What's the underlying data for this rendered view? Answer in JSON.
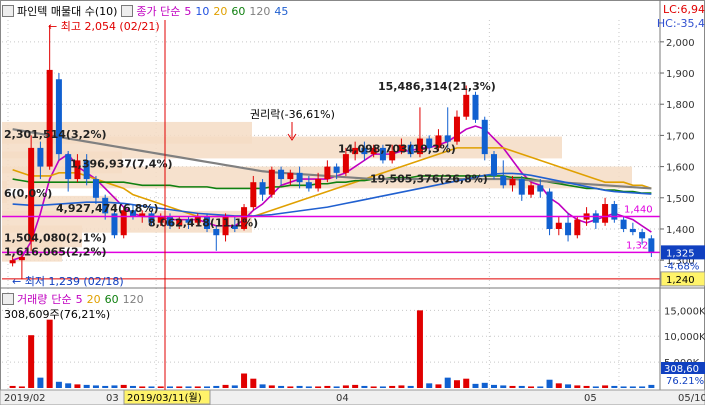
{
  "header": {
    "stock_name": "파인텍 매물대 수(10)",
    "ma_label": "종가 단순",
    "ma_periods": [
      "5",
      "10",
      "20",
      "60",
      "120",
      "45"
    ],
    "ma_colors": [
      "#c000c0",
      "#2050e0",
      "#e0a000",
      "#108010",
      "#808080",
      "#2060d0"
    ],
    "lc_text": "LC:6,94",
    "hc_text": "HC:-35,4"
  },
  "price_axis": {
    "ticks": [
      "2,000",
      "1,900",
      "1,800",
      "1,700",
      "1,600",
      "1,500",
      "1,400",
      "1,300"
    ],
    "current_price": "1,325",
    "current_change": "-4.68%",
    "low_line_label": "1,240"
  },
  "volume_axis": {
    "ticks": [
      "15,000K",
      "10,000K",
      "5,000K"
    ],
    "current_volume": "308,60",
    "current_ratio": "76.21%"
  },
  "volume_legend": {
    "label": "거래량",
    "ma_label": "단순",
    "periods": [
      "5",
      "20",
      "60",
      "120"
    ],
    "colors": [
      "#c000c0",
      "#e0a000",
      "#108010",
      "#808080"
    ],
    "current": "308,609주(76,21%)"
  },
  "date_axis": {
    "labels": [
      "2019/02",
      "03",
      "04",
      "05",
      "05/10"
    ],
    "cursor_label": "2019/03/11(월)"
  },
  "annotations": {
    "high": "최고 2,054 (02/21)",
    "low": "최저 1,239 (02/18)",
    "rights": "권리락(-36,61%)",
    "line_1440": "1,440",
    "line_1325": "1,32"
  },
  "volume_profile": [
    {
      "label": "2,301,514(3,2%)",
      "price": 1705,
      "len": 250
    },
    {
      "label": "14,098,703(19,3%)",
      "price": 1658,
      "len": 560
    },
    {
      "label": "15,486,314(21,3%)",
      "price": 1705,
      "len": 0
    },
    {
      "label": "1,396,937(7,4%)",
      "price": 1610,
      "len": 120
    },
    {
      "label": "19,505,376(26,8%)",
      "price": 1562,
      "len": 630
    },
    {
      "label": "6(0,0%)",
      "price": 1515,
      "len": 5
    },
    {
      "label": "4,927,474(6,8%)",
      "price": 1468,
      "len": 115
    },
    {
      "label": "8,062,418(11,1%)",
      "price": 1420,
      "len": 250
    },
    {
      "label": "1,504,080(2,1%)",
      "price": 1373,
      "len": 80
    },
    {
      "label": "1,616,065(2,2%)",
      "price": 1327,
      "len": 60
    }
  ],
  "chart_data": {
    "type": "candlestick",
    "ylim": [
      1230,
      2070
    ],
    "y_ticks": [
      2000,
      1900,
      1800,
      1700,
      1600,
      1500,
      1400,
      1300
    ],
    "candles": [
      {
        "o": 1290,
        "c": 1300,
        "h": 1315,
        "l": 1280
      },
      {
        "o": 1300,
        "c": 1310,
        "h": 1320,
        "l": 1239
      },
      {
        "o": 1360,
        "c": 1660,
        "h": 1700,
        "l": 1330
      },
      {
        "o": 1660,
        "c": 1600,
        "h": 1680,
        "l": 1560
      },
      {
        "o": 1600,
        "c": 1910,
        "h": 2054,
        "l": 1590
      },
      {
        "o": 1880,
        "c": 1640,
        "h": 1900,
        "l": 1620
      },
      {
        "o": 1640,
        "c": 1560,
        "h": 1650,
        "l": 1520
      },
      {
        "o": 1560,
        "c": 1620,
        "h": 1640,
        "l": 1550
      },
      {
        "o": 1620,
        "c": 1560,
        "h": 1640,
        "l": 1540
      },
      {
        "o": 1560,
        "c": 1500,
        "h": 1570,
        "l": 1480
      },
      {
        "o": 1500,
        "c": 1450,
        "h": 1510,
        "l": 1430
      },
      {
        "o": 1450,
        "c": 1380,
        "h": 1460,
        "l": 1370
      },
      {
        "o": 1380,
        "c": 1460,
        "h": 1470,
        "l": 1370
      },
      {
        "o": 1460,
        "c": 1440,
        "h": 1480,
        "l": 1430
      },
      {
        "o": 1440,
        "c": 1450,
        "h": 1460,
        "l": 1420
      },
      {
        "o": 1450,
        "c": 1420,
        "h": 1460,
        "l": 1410
      },
      {
        "o": 1420,
        "c": 1440,
        "h": 1450,
        "l": 1410
      },
      {
        "o": 1440,
        "c": 1410,
        "h": 1450,
        "l": 1400
      },
      {
        "o": 1410,
        "c": 1430,
        "h": 1440,
        "l": 1400
      },
      {
        "o": 1430,
        "c": 1420,
        "h": 1440,
        "l": 1400
      },
      {
        "o": 1420,
        "c": 1440,
        "h": 1450,
        "l": 1410
      },
      {
        "o": 1440,
        "c": 1400,
        "h": 1450,
        "l": 1390
      },
      {
        "o": 1400,
        "c": 1380,
        "h": 1410,
        "l": 1330
      },
      {
        "o": 1380,
        "c": 1440,
        "h": 1450,
        "l": 1360
      },
      {
        "o": 1410,
        "c": 1400,
        "h": 1440,
        "l": 1390
      },
      {
        "o": 1400,
        "c": 1470,
        "h": 1480,
        "l": 1395
      },
      {
        "o": 1470,
        "c": 1550,
        "h": 1570,
        "l": 1460
      },
      {
        "o": 1550,
        "c": 1510,
        "h": 1560,
        "l": 1490
      },
      {
        "o": 1510,
        "c": 1590,
        "h": 1600,
        "l": 1500
      },
      {
        "o": 1590,
        "c": 1560,
        "h": 1600,
        "l": 1540
      },
      {
        "o": 1560,
        "c": 1580,
        "h": 1590,
        "l": 1540
      },
      {
        "o": 1580,
        "c": 1550,
        "h": 1600,
        "l": 1530
      },
      {
        "o": 1550,
        "c": 1530,
        "h": 1570,
        "l": 1520
      },
      {
        "o": 1530,
        "c": 1560,
        "h": 1580,
        "l": 1520
      },
      {
        "o": 1560,
        "c": 1600,
        "h": 1620,
        "l": 1550
      },
      {
        "o": 1600,
        "c": 1580,
        "h": 1610,
        "l": 1560
      },
      {
        "o": 1580,
        "c": 1640,
        "h": 1660,
        "l": 1570
      },
      {
        "o": 1640,
        "c": 1660,
        "h": 1680,
        "l": 1620
      },
      {
        "o": 1660,
        "c": 1640,
        "h": 1680,
        "l": 1620
      },
      {
        "o": 1640,
        "c": 1660,
        "h": 1670,
        "l": 1630
      },
      {
        "o": 1660,
        "c": 1620,
        "h": 1670,
        "l": 1610
      },
      {
        "o": 1620,
        "c": 1650,
        "h": 1670,
        "l": 1610
      },
      {
        "o": 1650,
        "c": 1670,
        "h": 1690,
        "l": 1640
      },
      {
        "o": 1670,
        "c": 1640,
        "h": 1680,
        "l": 1630
      },
      {
        "o": 1640,
        "c": 1690,
        "h": 1790,
        "l": 1630
      },
      {
        "o": 1690,
        "c": 1660,
        "h": 1700,
        "l": 1640
      },
      {
        "o": 1660,
        "c": 1700,
        "h": 1720,
        "l": 1650
      },
      {
        "o": 1700,
        "c": 1680,
        "h": 1790,
        "l": 1660
      },
      {
        "o": 1680,
        "c": 1760,
        "h": 1780,
        "l": 1670
      },
      {
        "o": 1760,
        "c": 1830,
        "h": 1860,
        "l": 1750
      },
      {
        "o": 1830,
        "c": 1750,
        "h": 1840,
        "l": 1740
      },
      {
        "o": 1750,
        "c": 1640,
        "h": 1760,
        "l": 1620
      },
      {
        "o": 1640,
        "c": 1570,
        "h": 1650,
        "l": 1560
      },
      {
        "o": 1570,
        "c": 1540,
        "h": 1620,
        "l": 1530
      },
      {
        "o": 1540,
        "c": 1560,
        "h": 1570,
        "l": 1520
      },
      {
        "o": 1560,
        "c": 1510,
        "h": 1570,
        "l": 1490
      },
      {
        "o": 1510,
        "c": 1540,
        "h": 1550,
        "l": 1500
      },
      {
        "o": 1540,
        "c": 1520,
        "h": 1560,
        "l": 1500
      },
      {
        "o": 1520,
        "c": 1400,
        "h": 1530,
        "l": 1380
      },
      {
        "o": 1400,
        "c": 1420,
        "h": 1440,
        "l": 1380
      },
      {
        "o": 1420,
        "c": 1380,
        "h": 1450,
        "l": 1360
      },
      {
        "o": 1380,
        "c": 1430,
        "h": 1440,
        "l": 1370
      },
      {
        "o": 1430,
        "c": 1450,
        "h": 1470,
        "l": 1410
      },
      {
        "o": 1450,
        "c": 1420,
        "h": 1460,
        "l": 1400
      },
      {
        "o": 1420,
        "c": 1480,
        "h": 1500,
        "l": 1410
      },
      {
        "o": 1480,
        "c": 1430,
        "h": 1490,
        "l": 1420
      },
      {
        "o": 1430,
        "c": 1400,
        "h": 1440,
        "l": 1390
      },
      {
        "o": 1400,
        "c": 1390,
        "h": 1420,
        "l": 1380
      },
      {
        "o": 1390,
        "c": 1370,
        "h": 1400,
        "l": 1350
      },
      {
        "o": 1370,
        "c": 1325,
        "h": 1380,
        "l": 1310
      }
    ],
    "volume_ylim": [
      0,
      17000
    ],
    "volumes": [
      400,
      300,
      10200,
      2000,
      13200,
      1200,
      900,
      700,
      600,
      500,
      400,
      500,
      600,
      400,
      300,
      300,
      300,
      300,
      300,
      300,
      300,
      300,
      400,
      600,
      500,
      2800,
      1800,
      700,
      500,
      400,
      300,
      400,
      300,
      300,
      400,
      300,
      500,
      600,
      400,
      300,
      300,
      400,
      500,
      400,
      15000,
      900,
      700,
      2000,
      1500,
      1800,
      800,
      1000,
      600,
      500,
      400,
      400,
      300,
      300,
      1600,
      900,
      700,
      500,
      400,
      300,
      500,
      400,
      300,
      300,
      300,
      600
    ],
    "ma_series": [
      {
        "name": "5",
        "color": "#c000c0",
        "values": [
          1300,
          1310,
          1360,
          1450,
          1560,
          1620,
          1640,
          1600,
          1580,
          1560,
          1530,
          1500,
          1470,
          1450,
          1440,
          1440,
          1440,
          1430,
          1430,
          1430,
          1430,
          1420,
          1410,
          1410,
          1410,
          1430,
          1460,
          1480,
          1510,
          1540,
          1550,
          1560,
          1560,
          1560,
          1560,
          1570,
          1580,
          1600,
          1620,
          1640,
          1640,
          1640,
          1650,
          1650,
          1660,
          1660,
          1670,
          1680,
          1700,
          1720,
          1730,
          1720,
          1690,
          1660,
          1620,
          1580,
          1550,
          1540,
          1500,
          1480,
          1450,
          1430,
          1420,
          1430,
          1440,
          1450,
          1440,
          1430,
          1410,
          1390
        ]
      },
      {
        "name": "20",
        "color": "#e0a000",
        "values": [
          1590,
          1580,
          1570,
          1570,
          1570,
          1580,
          1580,
          1580,
          1570,
          1560,
          1550,
          1540,
          1530,
          1510,
          1500,
          1490,
          1480,
          1470,
          1460,
          1450,
          1440,
          1440,
          1440,
          1440,
          1440,
          1440,
          1440,
          1450,
          1460,
          1470,
          1480,
          1490,
          1500,
          1510,
          1520,
          1530,
          1540,
          1550,
          1560,
          1570,
          1580,
          1590,
          1600,
          1610,
          1620,
          1630,
          1640,
          1650,
          1660,
          1660,
          1660,
          1660,
          1660,
          1660,
          1650,
          1640,
          1630,
          1620,
          1610,
          1600,
          1590,
          1580,
          1570,
          1560,
          1550,
          1550,
          1550,
          1540,
          1540,
          1530
        ]
      },
      {
        "name": "60",
        "color": "#108010",
        "values": [
          1560,
          1555,
          1550,
          1550,
          1550,
          1550,
          1550,
          1550,
          1550,
          1550,
          1550,
          1550,
          1550,
          1545,
          1540,
          1540,
          1540,
          1540,
          1535,
          1535,
          1535,
          1535,
          1530,
          1530,
          1530,
          1530,
          1530,
          1530,
          1535,
          1535,
          1540,
          1540,
          1540,
          1545,
          1545,
          1550,
          1550,
          1555,
          1555,
          1560,
          1560,
          1565,
          1565,
          1565,
          1570,
          1570,
          1570,
          1570,
          1570,
          1570,
          1570,
          1570,
          1570,
          1570,
          1565,
          1565,
          1560,
          1555,
          1550,
          1545,
          1540,
          1535,
          1530,
          1530,
          1525,
          1525,
          1520,
          1520,
          1515,
          1515
        ]
      },
      {
        "name": "120",
        "color": "#808080",
        "values": [
          1720,
          1715,
          1710,
          1705,
          1700,
          1695,
          1690,
          1685,
          1680,
          1675,
          1670,
          1665,
          1660,
          1655,
          1650,
          1645,
          1640,
          1635,
          1630,
          1625,
          1620,
          1615,
          1610,
          1605,
          1600,
          1595,
          1590,
          1585,
          1582,
          1580,
          1578,
          1576,
          1574,
          1572,
          1570,
          1568,
          1566,
          1564,
          1562,
          1560,
          1560,
          1560,
          1560,
          1560,
          1560,
          1560,
          1560,
          1560,
          1560,
          1560,
          1560,
          1560,
          1560,
          1560,
          1560,
          1558,
          1556,
          1554,
          1552,
          1550,
          1548,
          1546,
          1544,
          1542,
          1540,
          1538,
          1536,
          1534,
          1532,
          1530
        ]
      },
      {
        "name": "45",
        "color": "#2060d0",
        "values": [
          1480,
          1478,
          1476,
          1476,
          1478,
          1480,
          1482,
          1484,
          1486,
          1486,
          1486,
          1484,
          1482,
          1478,
          1474,
          1470,
          1466,
          1462,
          1458,
          1454,
          1450,
          1448,
          1446,
          1444,
          1442,
          1442,
          1442,
          1444,
          1446,
          1450,
          1454,
          1458,
          1462,
          1466,
          1470,
          1476,
          1482,
          1488,
          1494,
          1500,
          1506,
          1512,
          1518,
          1524,
          1530,
          1536,
          1542,
          1548,
          1554,
          1560,
          1566,
          1572,
          1576,
          1578,
          1578,
          1576,
          1572,
          1566,
          1560,
          1554,
          1548,
          1542,
          1536,
          1530,
          1524,
          1520,
          1518,
          1516,
          1514,
          1512
        ]
      }
    ]
  }
}
